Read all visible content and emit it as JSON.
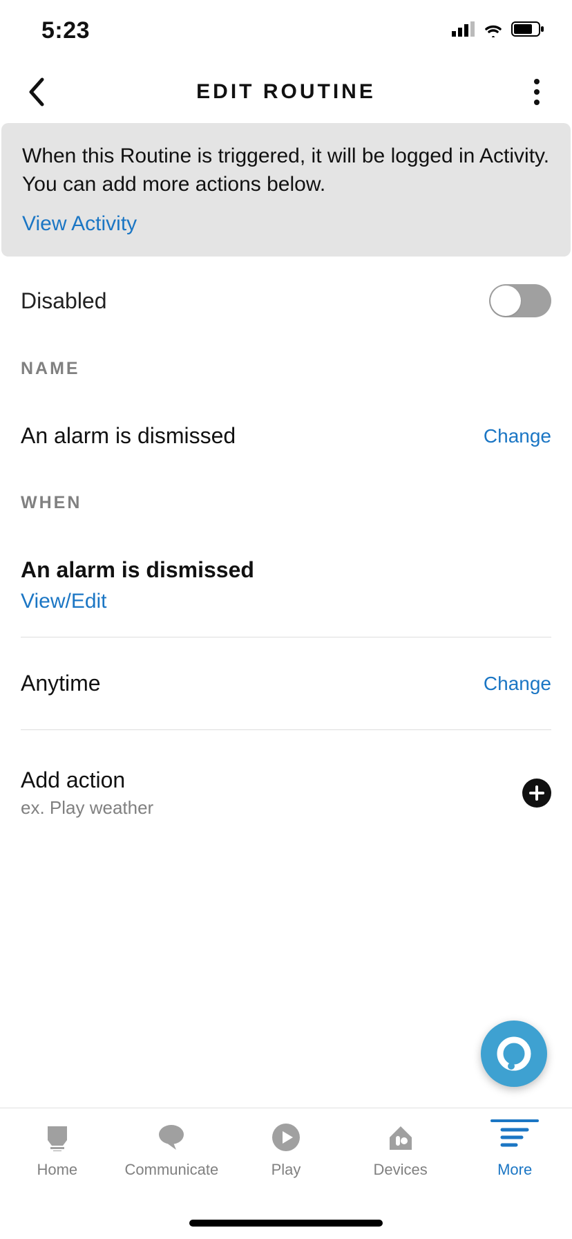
{
  "statusbar": {
    "time": "5:23"
  },
  "header": {
    "title": "EDIT ROUTINE"
  },
  "banner": {
    "text": "When this Routine is triggered, it will be logged in Activity. You can add more actions below.",
    "link": "View Activity"
  },
  "enabled": {
    "label": "Disabled",
    "state": "off"
  },
  "sections": {
    "name": {
      "label": "NAME",
      "value": "An alarm is dismissed",
      "change": "Change"
    },
    "when": {
      "label": "WHEN",
      "trigger": "An alarm is dismissed",
      "viewedit": "View/Edit",
      "time": "Anytime",
      "time_change": "Change"
    },
    "addaction": {
      "title": "Add action",
      "example": "ex. Play weather"
    }
  },
  "tabs": [
    {
      "id": "home",
      "label": "Home"
    },
    {
      "id": "communicate",
      "label": "Communicate"
    },
    {
      "id": "play",
      "label": "Play"
    },
    {
      "id": "devices",
      "label": "Devices"
    },
    {
      "id": "more",
      "label": "More"
    }
  ],
  "active_tab": "more"
}
